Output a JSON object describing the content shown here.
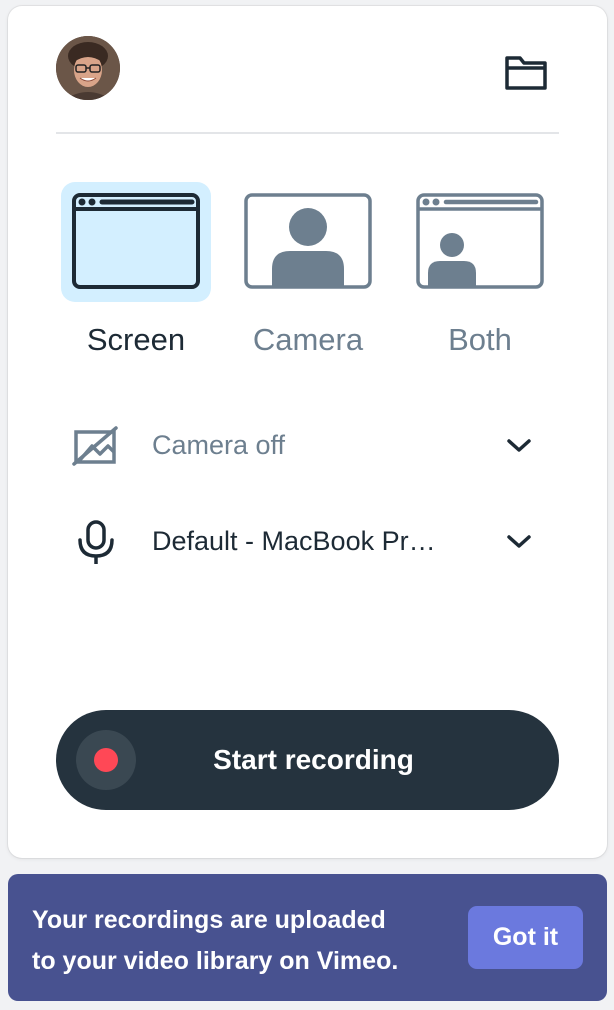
{
  "header": {
    "avatar_alt": "User avatar",
    "folder_icon": "folder-icon"
  },
  "modes": [
    {
      "label": "Screen",
      "icon": "screen-window-icon",
      "selected": true
    },
    {
      "label": "Camera",
      "icon": "camera-person-icon",
      "selected": false
    },
    {
      "label": "Both",
      "icon": "screen-and-camera-icon",
      "selected": false
    }
  ],
  "camera_select": {
    "icon": "camera-off-icon",
    "value": "Camera off"
  },
  "mic_select": {
    "icon": "microphone-icon",
    "value": "Default - MacBook Pr…"
  },
  "record": {
    "label": "Start recording"
  },
  "banner": {
    "line1": "Your recordings are uploaded",
    "line2": "to your video library on Vimeo.",
    "button_label": "Got it"
  },
  "colors": {
    "accent_selected": "#d3efff",
    "record_dot": "#ff4856",
    "record_bg": "#25333e",
    "banner_bg": "#485290",
    "banner_button": "#6b79de"
  }
}
